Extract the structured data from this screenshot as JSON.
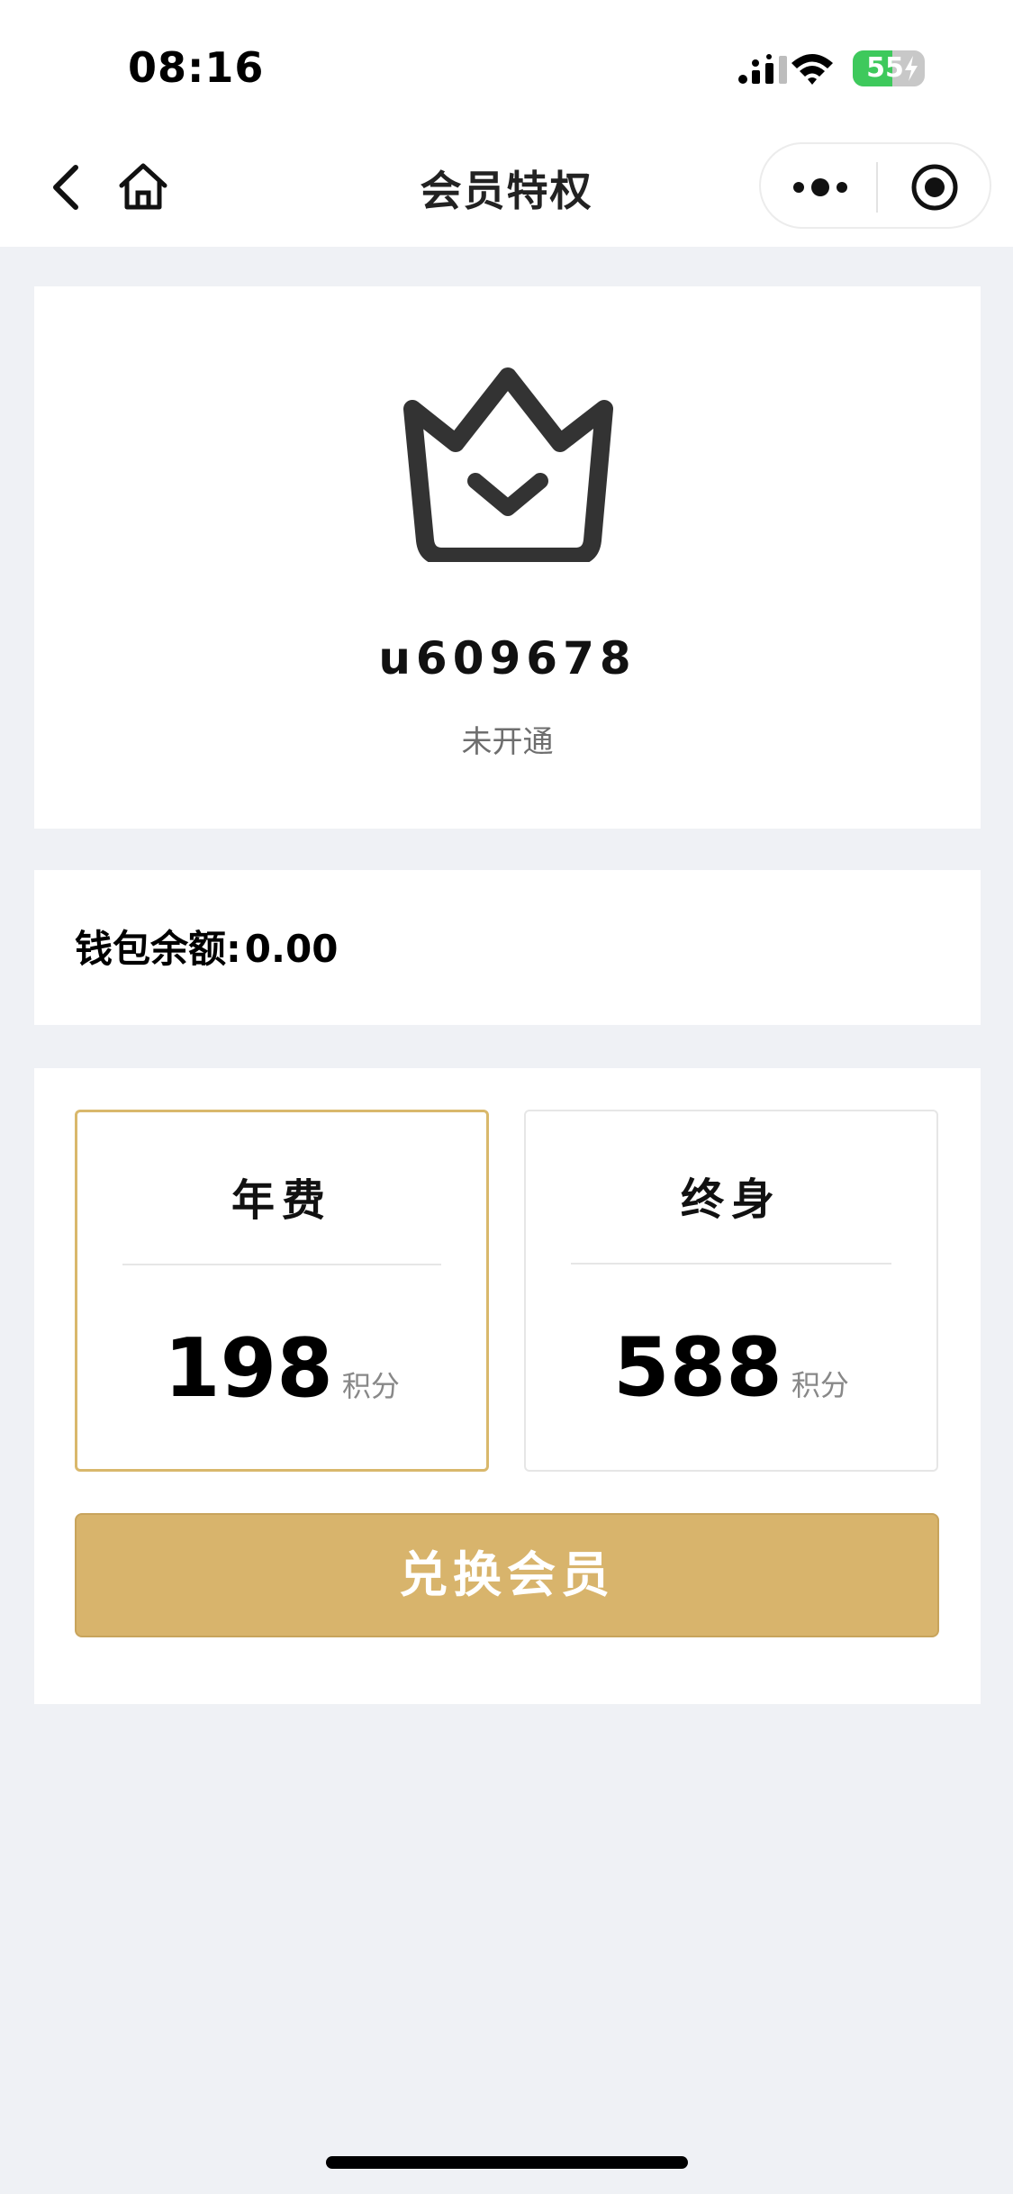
{
  "status_bar": {
    "time": "08:16",
    "battery_level": "55",
    "icons": [
      "signal-icon",
      "wifi-icon",
      "battery-icon",
      "charging-bolt-icon"
    ],
    "battery_color": "#3ec95c"
  },
  "nav": {
    "title": "会员特权",
    "icons": [
      "back-icon",
      "home-icon",
      "more-icon",
      "target-icon"
    ]
  },
  "profile": {
    "icon": "crown-icon",
    "username": "u609678",
    "status": "未开通"
  },
  "wallet": {
    "label": "钱包余额:",
    "value": "0.00"
  },
  "plans": [
    {
      "title": "年费",
      "price": "198",
      "unit": "积分",
      "selected": true
    },
    {
      "title": "终身",
      "price": "588",
      "unit": "积分",
      "selected": false
    }
  ],
  "redeem_button": {
    "label": "兑换会员",
    "color": "#d8b46c"
  },
  "colors": {
    "accent_gold": "#d8b46c",
    "selected_border": "#d9b86c",
    "page_background": "#eff1f5"
  }
}
